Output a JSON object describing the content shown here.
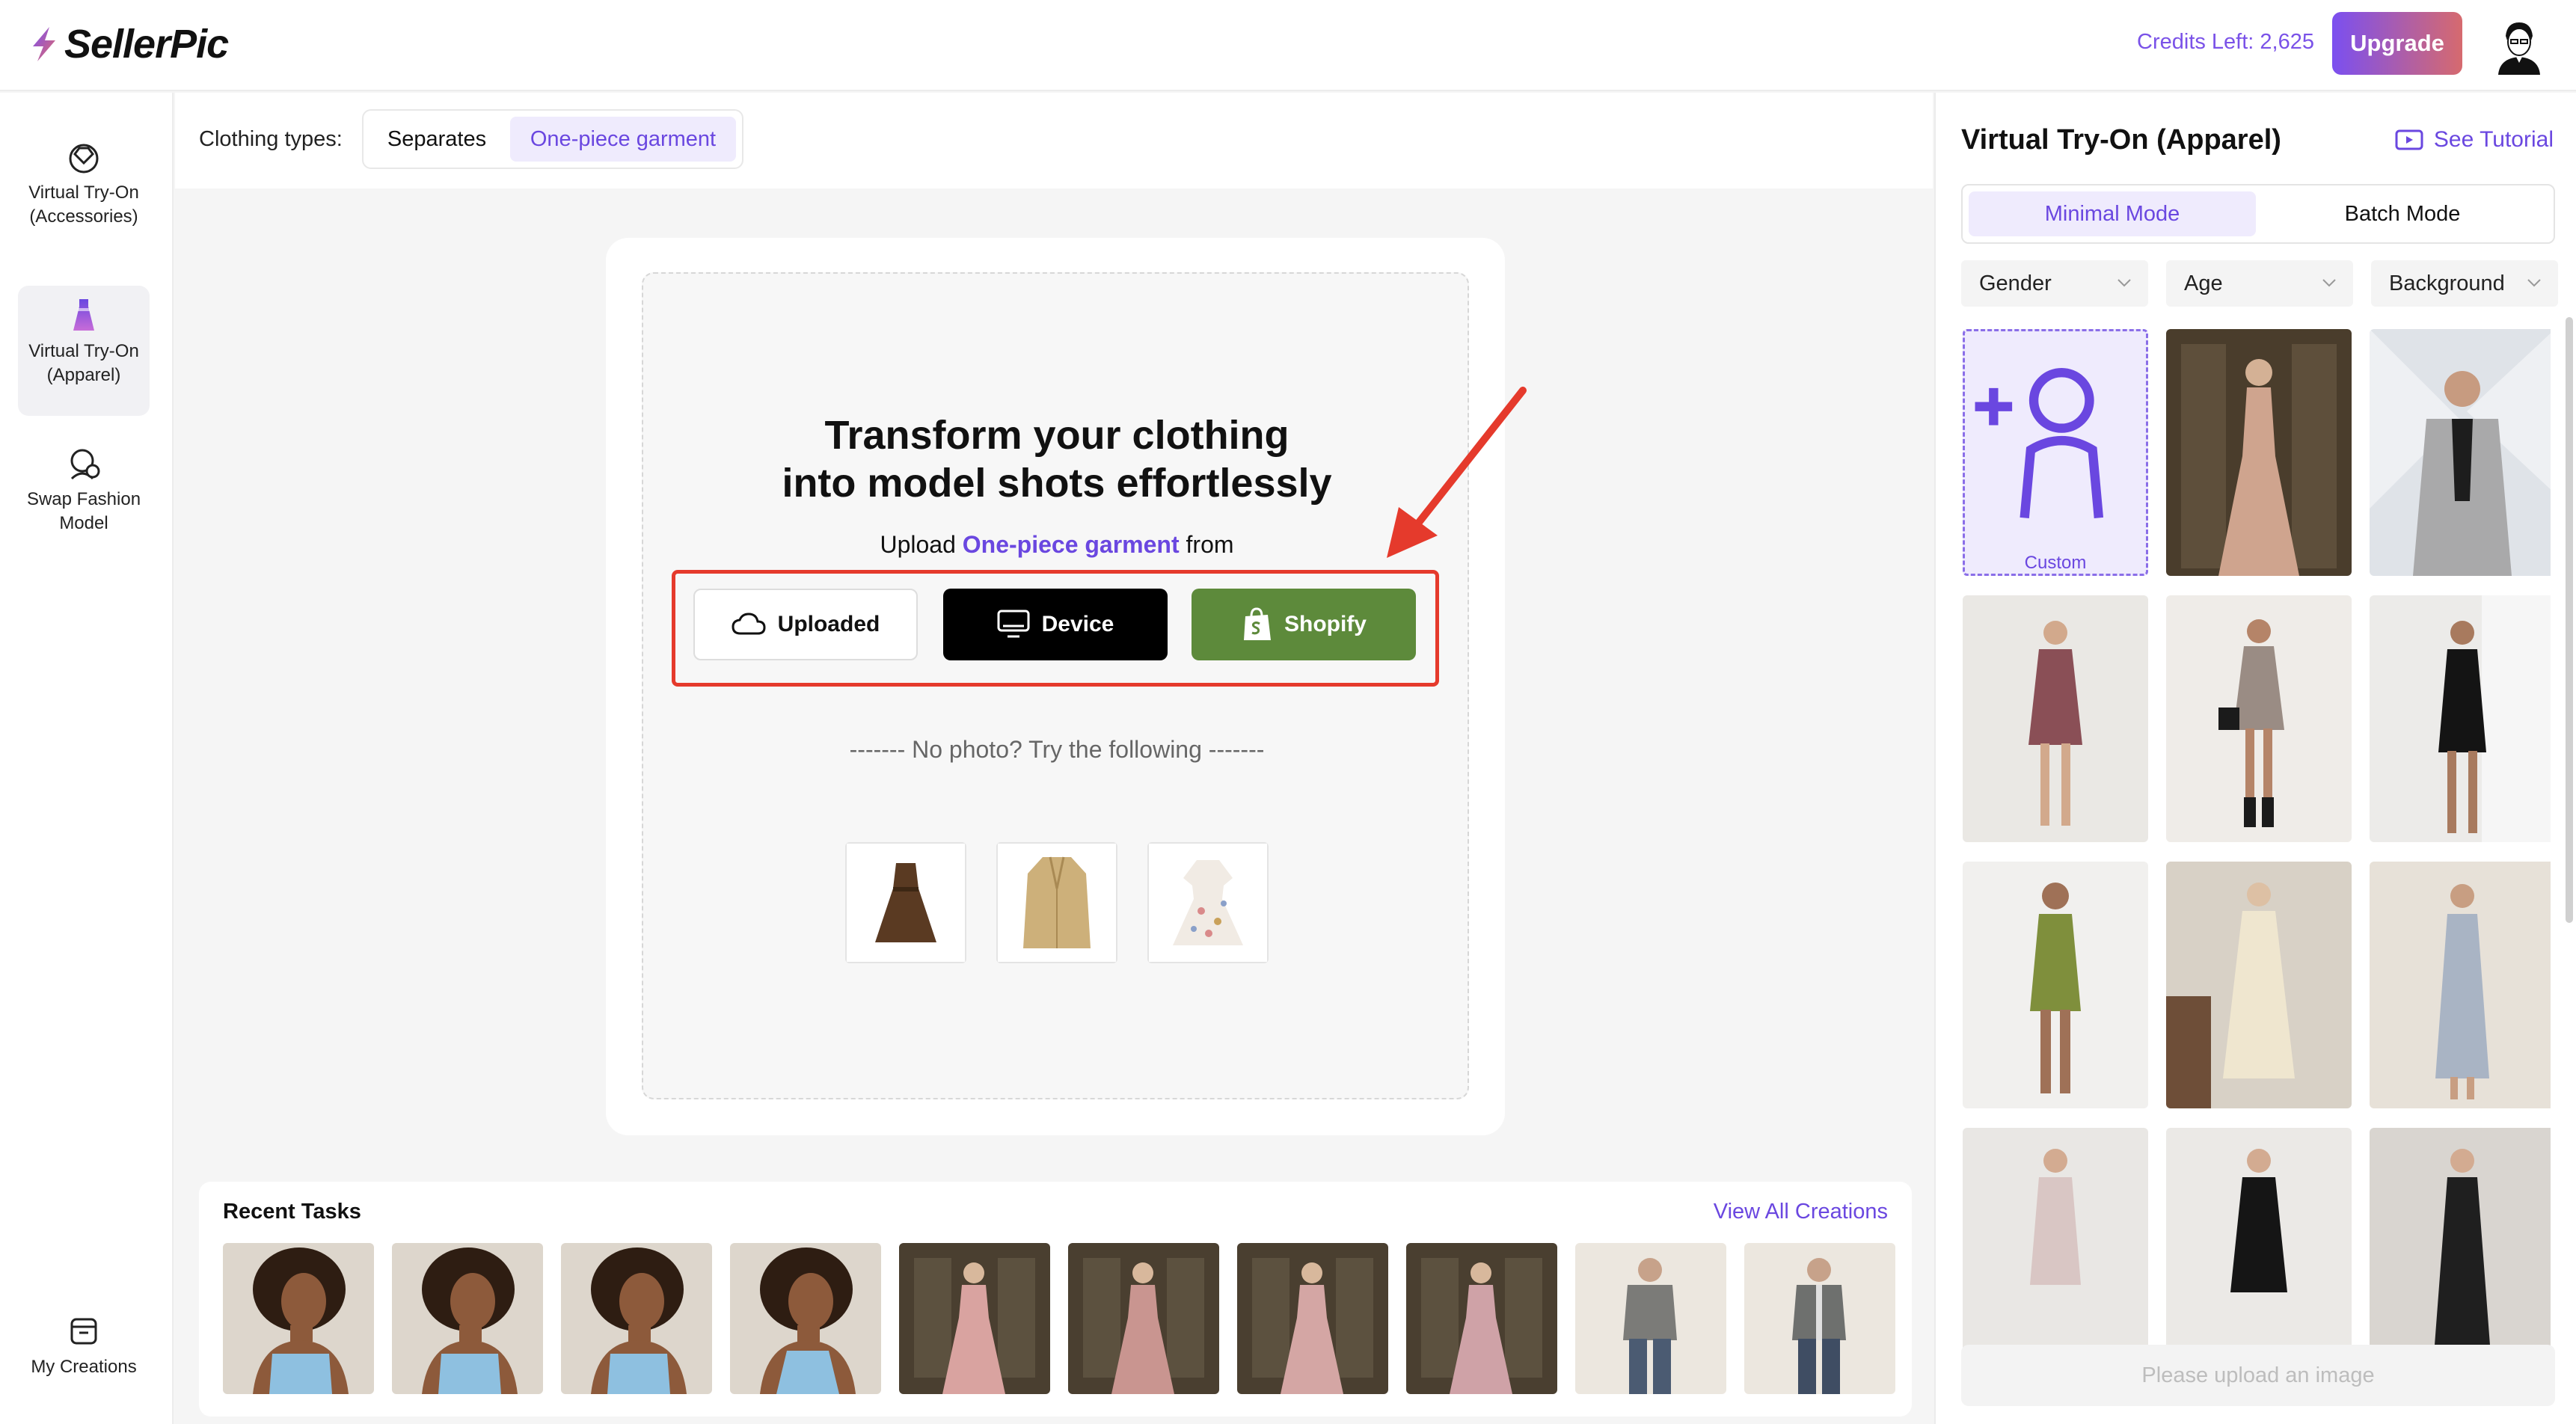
{
  "brand": {
    "name": "SellerPic",
    "accent": "#7a52e8"
  },
  "header": {
    "credits": "Credits Left: 2,625",
    "upgrade_label": "Upgrade"
  },
  "nav": {
    "items": [
      {
        "label": "Virtual Try-On (Accessories)",
        "icon": "gem-icon"
      },
      {
        "label": "Virtual Try-On (Apparel)",
        "icon": "dress-icon",
        "active": true
      },
      {
        "label": "Swap Fashion Model",
        "icon": "face-swap-icon"
      }
    ],
    "bottom": {
      "label": "My Creations",
      "icon": "folder-icon"
    }
  },
  "clothing": {
    "label": "Clothing types:",
    "options": [
      "Separates",
      "One-piece garment"
    ],
    "selected": "One-piece garment"
  },
  "upload": {
    "headline_1": "Transform your clothing",
    "headline_2": "into model shots effortlessly",
    "prefix": "Upload",
    "garment": "One-piece garment",
    "suffix": "from",
    "sources": {
      "uploaded": "Uploaded",
      "device": "Device",
      "shopify": "Shopify"
    },
    "no_photo": "------- No photo? Try the following -------",
    "samples": [
      "brown-dress",
      "beige-coat",
      "floral-dress"
    ]
  },
  "recent": {
    "title": "Recent Tasks",
    "view_all": "View All Creations"
  },
  "panel": {
    "title": "Virtual Try-On (Apparel)",
    "tutorial": "See Tutorial",
    "modes": [
      "Minimal Mode",
      "Batch Mode"
    ],
    "filters": [
      "Gender",
      "Age",
      "Background"
    ],
    "custom_label": "Custom",
    "upload_hint": "Please upload an image"
  }
}
